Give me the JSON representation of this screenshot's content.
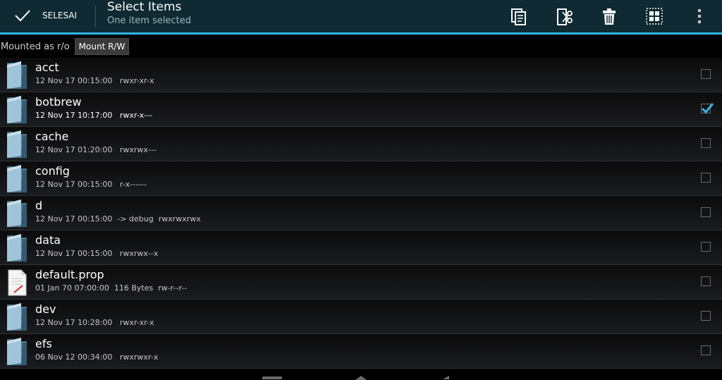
{
  "actionbar": {
    "done_label": "SELESAI",
    "title": "Select Items",
    "subtitle": "One item selected",
    "actions": [
      {
        "icon": "copy-icon"
      },
      {
        "icon": "cut-icon"
      },
      {
        "icon": "delete-icon"
      },
      {
        "icon": "select-all-icon"
      },
      {
        "icon": "overflow-menu-icon"
      }
    ]
  },
  "mount": {
    "status": "Mounted as r/o",
    "button_label": "Mount R/W"
  },
  "files": [
    {
      "name": "acct",
      "meta": "12 Nov 17 00:15:00   rwxr-xr-x",
      "type": "folder",
      "checked": false
    },
    {
      "name": "botbrew",
      "meta": "12 Nov 17 10:17:00   rwxr-x---",
      "type": "folder",
      "checked": true
    },
    {
      "name": "cache",
      "meta": "12 Nov 17 01:20:00   rwxrwx---",
      "type": "folder",
      "checked": false
    },
    {
      "name": "config",
      "meta": "12 Nov 17 00:15:00   r-x------",
      "type": "folder",
      "checked": false
    },
    {
      "name": "d",
      "meta": "12 Nov 17 00:15:00  -> debug  rwxrwxrwx",
      "type": "folder",
      "checked": false
    },
    {
      "name": "data",
      "meta": "12 Nov 17 00:15:00   rwxrwx--x",
      "type": "folder",
      "checked": false
    },
    {
      "name": "default.prop",
      "meta": "01 Jan 70 07:00:00  116 Bytes  rw-r--r--",
      "type": "file",
      "checked": false
    },
    {
      "name": "dev",
      "meta": "12 Nov 17 10:28:00   rwxr-xr-x",
      "type": "folder",
      "checked": false
    },
    {
      "name": "efs",
      "meta": "06 Nov 12 00:34:00   rwxrwxr-x",
      "type": "folder",
      "checked": false
    }
  ],
  "colors": {
    "accent": "#33b5e5",
    "actionbar_bg": "#0f2a33",
    "folder": "#7fa7c0"
  }
}
